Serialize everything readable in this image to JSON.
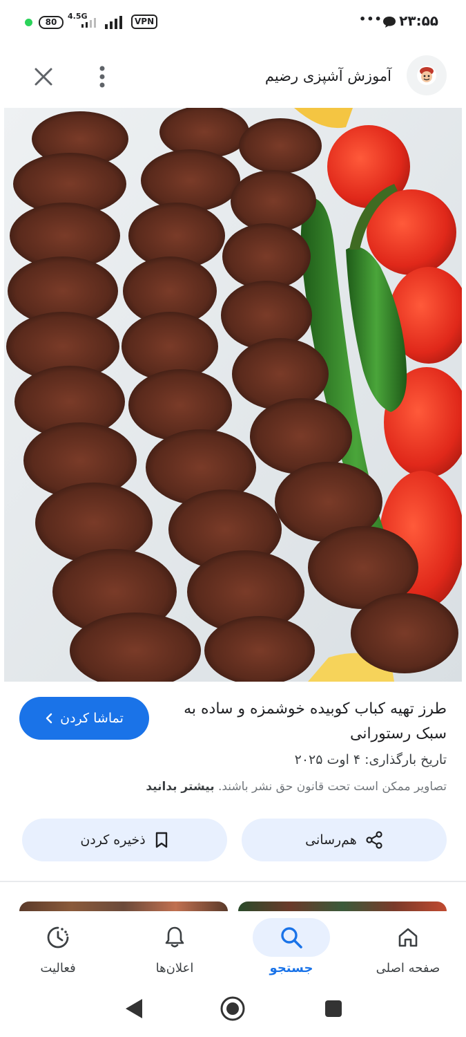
{
  "status_bar": {
    "battery": "80",
    "network": "4.5G",
    "vpn": "VPN",
    "more": "•••",
    "time": "۲۳:۵۵"
  },
  "header": {
    "site_name": "آموزش آشپزی رضیم",
    "close_icon": "close-icon",
    "menu_icon": "more-vert-icon"
  },
  "result": {
    "title": "طرز تهیه کباب کوبیده خوشمزه و ساده به سبک رستورانی",
    "watch_label": "تماشا کردن",
    "upload_date": "تاریخ بارگذاری: ۴ اوت ۲۰۲۵",
    "copyright_text": "تصاویر ممکن است تحت قانون حق نشر باشند.",
    "learn_more": "بیشتر بدانید"
  },
  "actions": {
    "share_label": "هم‌رسانی",
    "save_label": "ذخیره کردن"
  },
  "bottom_nav": [
    {
      "label": "صفحه اصلی",
      "icon": "home-icon"
    },
    {
      "label": "جستجو",
      "icon": "search-icon"
    },
    {
      "label": "اعلان‌ها",
      "icon": "bell-icon"
    },
    {
      "label": "فعالیت",
      "icon": "activity-icon"
    }
  ],
  "colors": {
    "accent": "#1a73e8",
    "chip_bg": "#e8f0fe"
  }
}
